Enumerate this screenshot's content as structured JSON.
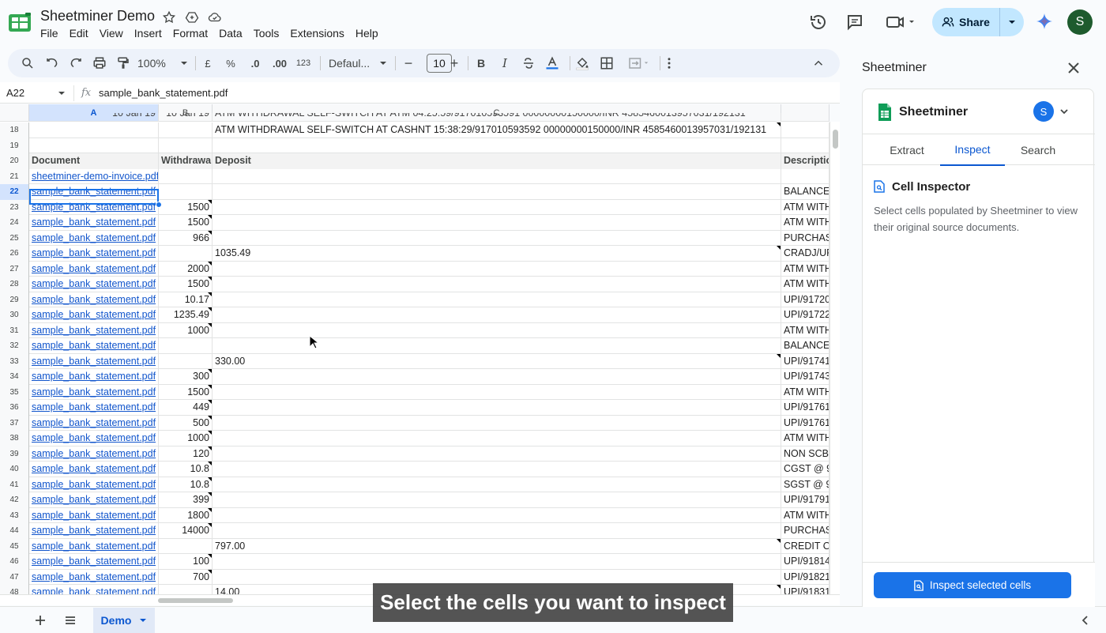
{
  "document": {
    "title": "Sheetminer Demo",
    "menu": [
      "File",
      "Edit",
      "View",
      "Insert",
      "Format",
      "Data",
      "Tools",
      "Extensions",
      "Help"
    ]
  },
  "header": {
    "share_label": "Share",
    "avatar_letter": "S"
  },
  "toolbar": {
    "zoom": "100%",
    "currency": "£",
    "percent": "%",
    "dec_decrease": ".0",
    "dec_increase": ".00",
    "number_format": "123",
    "font": "Defaul...",
    "font_size": "10",
    "bold": "B",
    "italic": "I"
  },
  "formula_bar": {
    "name_box": "A22",
    "fx": "fx",
    "value": "sample_bank_statement.pdf"
  },
  "columns": [
    "A",
    "B",
    "C"
  ],
  "partial_row_text": {
    "a": "10 Jan 19",
    "b": "10 Jan 19",
    "c": "ATM WITHDRAWAL SELF-SWITCH AT ATM 04:25:59/917010593591 00000000150000/INR 4585460013957031/192131"
  },
  "rows": [
    {
      "n": "18",
      "a": "",
      "b": "",
      "c": "ATM WITHDRAWAL SELF-SWITCH AT CASHNT 15:38:29/917010593592 00000000150000/INR 4585460013957031/192131",
      "d": "",
      "mb": false,
      "mc": true
    },
    {
      "n": "19",
      "a": "",
      "b": "",
      "c": "",
      "d": ""
    },
    {
      "n": "20",
      "a": "Document",
      "b": "Withdrawal",
      "c": "Deposit",
      "d": "Description",
      "hdr": true
    },
    {
      "n": "21",
      "a": "sheetminer-demo-invoice.pdf",
      "b": "",
      "c": "",
      "d": ""
    },
    {
      "n": "22",
      "a": "sample_bank_statement.pdf",
      "b": "",
      "c": "",
      "d": "BALANCE",
      "sel": true
    },
    {
      "n": "23",
      "a": "sample_bank_statement.pdf",
      "b": "1500",
      "c": "",
      "d": "ATM WITH",
      "mb": true
    },
    {
      "n": "24",
      "a": "sample_bank_statement.pdf",
      "b": "1500",
      "c": "",
      "d": "ATM WITH",
      "mb": true
    },
    {
      "n": "25",
      "a": "sample_bank_statement.pdf",
      "b": "966",
      "c": "",
      "d": "PURCHAS",
      "mb": true
    },
    {
      "n": "26",
      "a": "sample_bank_statement.pdf",
      "b": "",
      "c": "1035.49",
      "d": "CRADJ/UP",
      "mc": true
    },
    {
      "n": "27",
      "a": "sample_bank_statement.pdf",
      "b": "2000",
      "c": "",
      "d": "ATM WITH",
      "mb": true
    },
    {
      "n": "28",
      "a": "sample_bank_statement.pdf",
      "b": "1500",
      "c": "",
      "d": "ATM WITH",
      "mb": true
    },
    {
      "n": "29",
      "a": "sample_bank_statement.pdf",
      "b": "10.17",
      "c": "",
      "d": "UPI/91720",
      "mb": true
    },
    {
      "n": "30",
      "a": "sample_bank_statement.pdf",
      "b": "1235.49",
      "c": "",
      "d": "UPI/91722",
      "mb": true
    },
    {
      "n": "31",
      "a": "sample_bank_statement.pdf",
      "b": "1000",
      "c": "",
      "d": "ATM WITH",
      "mb": true
    },
    {
      "n": "32",
      "a": "sample_bank_statement.pdf",
      "b": "",
      "c": "",
      "d": "BALANCE"
    },
    {
      "n": "33",
      "a": "sample_bank_statement.pdf",
      "b": "",
      "c": "330.00",
      "d": "UPI/91741",
      "mc": true
    },
    {
      "n": "34",
      "a": "sample_bank_statement.pdf",
      "b": "300",
      "c": "",
      "d": "UPI/91743",
      "mb": true
    },
    {
      "n": "35",
      "a": "sample_bank_statement.pdf",
      "b": "1500",
      "c": "",
      "d": "ATM WITH",
      "mb": true
    },
    {
      "n": "36",
      "a": "sample_bank_statement.pdf",
      "b": "449",
      "c": "",
      "d": "UPI/91761",
      "mb": true
    },
    {
      "n": "37",
      "a": "sample_bank_statement.pdf",
      "b": "500",
      "c": "",
      "d": "UPI/91761",
      "mb": true
    },
    {
      "n": "38",
      "a": "sample_bank_statement.pdf",
      "b": "1000",
      "c": "",
      "d": "ATM WITH",
      "mb": true
    },
    {
      "n": "39",
      "a": "sample_bank_statement.pdf",
      "b": "120",
      "c": "",
      "d": "NON SCB",
      "mb": true
    },
    {
      "n": "40",
      "a": "sample_bank_statement.pdf",
      "b": "10.8",
      "c": "",
      "d": "CGST @ 9",
      "mb": true
    },
    {
      "n": "41",
      "a": "sample_bank_statement.pdf",
      "b": "10.8",
      "c": "",
      "d": "SGST @ 9",
      "mb": true
    },
    {
      "n": "42",
      "a": "sample_bank_statement.pdf",
      "b": "399",
      "c": "",
      "d": "UPI/91791",
      "mb": true
    },
    {
      "n": "43",
      "a": "sample_bank_statement.pdf",
      "b": "1800",
      "c": "",
      "d": "ATM WITH",
      "mb": true
    },
    {
      "n": "44",
      "a": "sample_bank_statement.pdf",
      "b": "14000",
      "c": "",
      "d": "PURCHAS",
      "mb": true
    },
    {
      "n": "45",
      "a": "sample_bank_statement.pdf",
      "b": "",
      "c": "797.00",
      "d": "CREDIT O",
      "mc": true
    },
    {
      "n": "46",
      "a": "sample_bank_statement.pdf",
      "b": "100",
      "c": "",
      "d": "UPI/91814",
      "mb": true
    },
    {
      "n": "47",
      "a": "sample_bank_statement.pdf",
      "b": "700",
      "c": "",
      "d": "UPI/91821",
      "mb": true
    },
    {
      "n": "48",
      "a": "sample_bank_statement.pdf",
      "b": "",
      "c": "14.00",
      "d": "UPI/91831",
      "mc": true
    }
  ],
  "sheets": {
    "active_tab": "Demo"
  },
  "caption": "Select the cells you want to inspect",
  "side_panel": {
    "title": "Sheetminer",
    "app_name": "Sheetminer",
    "avatar_letter": "S",
    "tabs": [
      "Extract",
      "Inspect",
      "Search"
    ],
    "active_tab": "Inspect",
    "inspector_title": "Cell Inspector",
    "inspector_description": "Select cells populated by Sheetminer to view their original source documents.",
    "inspect_button": "Inspect selected cells"
  },
  "colors": {
    "accent": "#1a73e8",
    "link": "#1155cc",
    "share_bg": "#c2e7ff",
    "sheets_green": "#0f9d58"
  }
}
